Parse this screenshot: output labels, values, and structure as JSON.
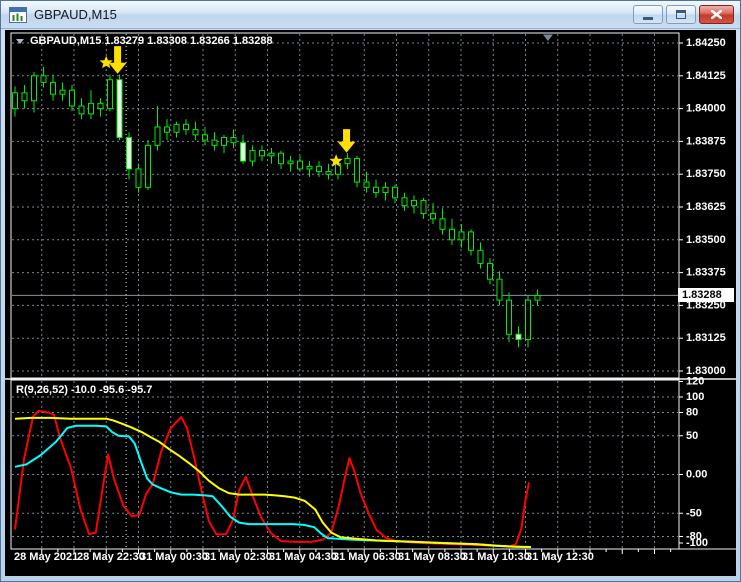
{
  "window": {
    "title": "GBPAUD,M15",
    "controls": {
      "minimize": "minimize",
      "restore": "restore",
      "close": "close"
    }
  },
  "chart": {
    "info_line": "GBPAUD,M15 1.83279 1.83308 1.83266 1.83288",
    "open": "1.83279",
    "high": "1.83308",
    "low": "1.83266",
    "close": "1.83288",
    "current_price": "1.83288"
  },
  "indicator": {
    "label": "R(9,26,52) -10.0 -95.6 -95.7"
  },
  "colors": {
    "background": "#000000",
    "grid": "#778899",
    "separator": "#e6ecf2",
    "panel_border": "#f2f2f2",
    "bar": "#00ee00",
    "solid_body_fill": "#eeffee",
    "hollow_body_fill": "#000000",
    "marker": "#ffdf00",
    "price_line": "#8d959d",
    "shift_marker": "#778899",
    "axis_text": "#ffffff",
    "tag_bg": "#ffffff",
    "tag_text": "#000000",
    "r9": "#ff0000",
    "r26": "#00ffff",
    "r52": "#ffff00"
  },
  "time_axis": {
    "labels": [
      "28 May 2021",
      "28 May 22:30",
      "31 May 00:30",
      "31 May 02:30",
      "31 May 04:30",
      "31 May 06:30",
      "31 May 08:30",
      "31 May 10:30",
      "31 May 12:30"
    ]
  },
  "chart_data": {
    "type": "candlestick",
    "symbol": "GBPAUD",
    "timeframe": "M15",
    "price_axis_labels": [
      "1.84250",
      "1.84125",
      "1.84000",
      "1.83875",
      "1.83750",
      "1.83625",
      "1.83500",
      "1.83375",
      "1.83250",
      "1.83125",
      "1.83000"
    ],
    "current_price": 1.83288,
    "day_separator_candle": 11.7,
    "shift_marker_candle": 56.1,
    "candles": [
      [
        1.84,
        1.84085,
        1.8397,
        1.8406
      ],
      [
        1.8406,
        1.8409,
        1.84,
        1.8403
      ],
      [
        1.8403,
        1.8414,
        1.83985,
        1.84125
      ],
      [
        1.84125,
        1.8416,
        1.8408,
        1.841
      ],
      [
        1.841,
        1.8413,
        1.8403,
        1.84055
      ],
      [
        1.84055,
        1.841,
        1.8403,
        1.8407
      ],
      [
        1.8407,
        1.8409,
        1.8399,
        1.8401
      ],
      [
        1.8401,
        1.8404,
        1.8396,
        1.8398
      ],
      [
        1.8398,
        1.8407,
        1.8396,
        1.8402
      ],
      [
        1.8402,
        1.8404,
        1.8397,
        1.84
      ],
      [
        1.84,
        1.8413,
        1.8399,
        1.8411
      ],
      [
        1.8411,
        1.8413,
        1.8388,
        1.8389,
        1
      ],
      [
        1.8389,
        1.8391,
        1.8373,
        1.8377,
        1
      ],
      [
        1.8377,
        1.8379,
        1.8368,
        1.837
      ],
      [
        1.837,
        1.8388,
        1.8369,
        1.8386
      ],
      [
        1.8386,
        1.8401,
        1.8384,
        1.8393
      ],
      [
        1.8393,
        1.8396,
        1.8388,
        1.8391
      ],
      [
        1.8391,
        1.8395,
        1.8389,
        1.8394
      ],
      [
        1.8394,
        1.8396,
        1.839,
        1.8392
      ],
      [
        1.8392,
        1.8395,
        1.8388,
        1.839
      ],
      [
        1.839,
        1.8393,
        1.8386,
        1.8388
      ],
      [
        1.8388,
        1.8391,
        1.8384,
        1.8386
      ],
      [
        1.8386,
        1.839,
        1.8383,
        1.8389
      ],
      [
        1.8389,
        1.8392,
        1.8385,
        1.8387
      ],
      [
        1.8387,
        1.839,
        1.8379,
        1.838,
        1
      ],
      [
        1.838,
        1.8386,
        1.8378,
        1.8384
      ],
      [
        1.8384,
        1.8386,
        1.838,
        1.8382
      ],
      [
        1.8382,
        1.8385,
        1.8379,
        1.8383
      ],
      [
        1.8383,
        1.8384,
        1.8377,
        1.8379
      ],
      [
        1.8379,
        1.8382,
        1.8376,
        1.838
      ],
      [
        1.838,
        1.8382,
        1.8376,
        1.8377
      ],
      [
        1.8377,
        1.838,
        1.8374,
        1.8378
      ],
      [
        1.8378,
        1.838,
        1.8374,
        1.8376
      ],
      [
        1.8376,
        1.8379,
        1.8373,
        1.8375
      ],
      [
        1.8375,
        1.838,
        1.8373,
        1.8379
      ],
      [
        1.8379,
        1.8383,
        1.8377,
        1.8381
      ],
      [
        1.8381,
        1.8382,
        1.837,
        1.8372
      ],
      [
        1.8372,
        1.8376,
        1.8368,
        1.837
      ],
      [
        1.837,
        1.8373,
        1.8366,
        1.8368
      ],
      [
        1.8368,
        1.8372,
        1.8365,
        1.837
      ],
      [
        1.837,
        1.8371,
        1.8364,
        1.8366
      ],
      [
        1.8366,
        1.8368,
        1.8361,
        1.8363
      ],
      [
        1.8363,
        1.8367,
        1.836,
        1.8365
      ],
      [
        1.8365,
        1.8366,
        1.8358,
        1.836
      ],
      [
        1.836,
        1.8364,
        1.8356,
        1.8358
      ],
      [
        1.8358,
        1.8362,
        1.8352,
        1.8354
      ],
      [
        1.8354,
        1.8358,
        1.8348,
        1.835
      ],
      [
        1.835,
        1.8356,
        1.8347,
        1.8353
      ],
      [
        1.8353,
        1.8354,
        1.8344,
        1.8346
      ],
      [
        1.8346,
        1.8349,
        1.8339,
        1.8341
      ],
      [
        1.8341,
        1.8343,
        1.8333,
        1.8335
      ],
      [
        1.8335,
        1.8338,
        1.8325,
        1.8327
      ],
      [
        1.8327,
        1.833,
        1.8311,
        1.8314
      ],
      [
        1.8314,
        1.8317,
        1.8309,
        1.8312,
        1
      ],
      [
        1.8312,
        1.8329,
        1.8309,
        1.8327
      ],
      [
        1.8327,
        1.8331,
        1.8325,
        1.83288
      ]
    ],
    "markers": [
      {
        "shape": "star",
        "candle": 9.6,
        "price": 1.84175
      },
      {
        "shape": "arrow-down",
        "candle": 10.8,
        "price_tail": 1.84238,
        "price_tip": 1.84133
      },
      {
        "shape": "star",
        "candle": 33.8,
        "price": 1.838
      },
      {
        "shape": "arrow-down",
        "candle": 34.9,
        "price_tail": 1.83922,
        "price_tip": 1.83832
      }
    ],
    "oscillator": {
      "name": "R",
      "params": [
        9,
        26,
        52
      ],
      "current_values": [
        -10.0,
        -95.6,
        -95.7
      ],
      "axis_labels": [
        "120",
        "100",
        "80",
        "50",
        "0.00",
        "-50",
        "-80",
        "-100"
      ],
      "range_hint": [
        120,
        -100
      ],
      "series": [
        {
          "name": "R9",
          "color_key": "r9",
          "points": [
            [
              0,
              -71
            ],
            [
              0.95,
              20
            ],
            [
              1.9,
              75
            ],
            [
              2.5,
              82
            ],
            [
              3.5,
              80
            ],
            [
              4.1,
              77
            ],
            [
              4.8,
              45
            ],
            [
              5.9,
              8
            ],
            [
              6.9,
              -45
            ],
            [
              7.8,
              -77
            ],
            [
              8.5,
              -75
            ],
            [
              9.2,
              -20
            ],
            [
              9.8,
              26
            ],
            [
              10.4,
              -5
            ],
            [
              11.4,
              -40
            ],
            [
              12.3,
              -54
            ],
            [
              13.1,
              -52
            ],
            [
              13.8,
              -25
            ],
            [
              14.5,
              -12
            ],
            [
              15.4,
              30
            ],
            [
              16.4,
              60
            ],
            [
              17.5,
              74
            ],
            [
              18.1,
              60
            ],
            [
              18.9,
              20
            ],
            [
              19.8,
              -30
            ],
            [
              20.4,
              -60
            ],
            [
              21.2,
              -77
            ],
            [
              22.2,
              -77
            ],
            [
              22.9,
              -60
            ],
            [
              23.6,
              -20
            ],
            [
              24.3,
              -3
            ],
            [
              25.1,
              -30
            ],
            [
              25.9,
              -55
            ],
            [
              26.9,
              -75
            ],
            [
              28,
              -86
            ],
            [
              29.6,
              -87
            ],
            [
              31.2,
              -87
            ],
            [
              32.4,
              -84
            ],
            [
              33.3,
              -75
            ],
            [
              34.1,
              -40
            ],
            [
              34.7,
              -5
            ],
            [
              35.2,
              21
            ],
            [
              35.7,
              5
            ],
            [
              36.4,
              -25
            ],
            [
              37.3,
              -52
            ],
            [
              38.1,
              -72
            ],
            [
              39.1,
              -82
            ],
            [
              40.1,
              -86
            ],
            [
              42.2,
              -88
            ],
            [
              44.3,
              -89
            ],
            [
              46.4,
              -90
            ],
            [
              48.5,
              -91
            ],
            [
              50.6,
              -92
            ],
            [
              52,
              -93
            ],
            [
              52.7,
              -90
            ],
            [
              53.3,
              -70
            ],
            [
              53.7,
              -35
            ],
            [
              54.1,
              -10
            ]
          ]
        },
        {
          "name": "R26",
          "color_key": "r26",
          "points": [
            [
              0,
              10
            ],
            [
              1.2,
              13
            ],
            [
              2.7,
              25
            ],
            [
              4.3,
              42
            ],
            [
              5.5,
              60
            ],
            [
              6.4,
              63
            ],
            [
              7.5,
              63
            ],
            [
              8.5,
              63
            ],
            [
              9.6,
              62
            ],
            [
              10.2,
              55
            ],
            [
              10.9,
              50
            ],
            [
              12,
              49
            ],
            [
              12.6,
              40
            ],
            [
              13.3,
              15
            ],
            [
              13.9,
              -5
            ],
            [
              14.5,
              -13
            ],
            [
              15.4,
              -18
            ],
            [
              16.4,
              -23
            ],
            [
              17.5,
              -26
            ],
            [
              18.7,
              -26
            ],
            [
              20,
              -27
            ],
            [
              20.8,
              -28
            ],
            [
              21.7,
              -40
            ],
            [
              22.7,
              -55
            ],
            [
              23.6,
              -62
            ],
            [
              24.6,
              -64
            ],
            [
              26.1,
              -64
            ],
            [
              27.8,
              -64
            ],
            [
              29.3,
              -64
            ],
            [
              30.4,
              -65
            ],
            [
              31.5,
              -68
            ],
            [
              32.2,
              -76
            ],
            [
              32.9,
              -82
            ],
            [
              34,
              -83
            ],
            [
              35.4,
              -84
            ],
            [
              37.3,
              -85
            ],
            [
              39.6,
              -86
            ],
            [
              41.9,
              -87
            ],
            [
              44.2,
              -88
            ],
            [
              46.5,
              -89
            ],
            [
              48.8,
              -90
            ],
            [
              50.9,
              -92
            ],
            [
              52.4,
              -93
            ],
            [
              53.5,
              -94
            ],
            [
              54.3,
              -95.6
            ]
          ]
        },
        {
          "name": "R52",
          "color_key": "r52",
          "points": [
            [
              0,
              72
            ],
            [
              1.7,
              73
            ],
            [
              3.8,
              73
            ],
            [
              5.9,
              72
            ],
            [
              8,
              72
            ],
            [
              9.6,
              72
            ],
            [
              10.3,
              70
            ],
            [
              11.2,
              66
            ],
            [
              12.2,
              61
            ],
            [
              13.3,
              55
            ],
            [
              14.3,
              48
            ],
            [
              15.2,
              42
            ],
            [
              16.2,
              33
            ],
            [
              17.3,
              24
            ],
            [
              18.3,
              15
            ],
            [
              19.4,
              4
            ],
            [
              20.4,
              -8
            ],
            [
              21.5,
              -18
            ],
            [
              22.5,
              -24
            ],
            [
              23.6,
              -26
            ],
            [
              25.1,
              -26
            ],
            [
              26.3,
              -26
            ],
            [
              27.4,
              -27
            ],
            [
              28.4,
              -28
            ],
            [
              29.5,
              -30
            ],
            [
              30.5,
              -34
            ],
            [
              31.6,
              -45
            ],
            [
              32.4,
              -62
            ],
            [
              33.3,
              -75
            ],
            [
              34.3,
              -81
            ],
            [
              35.9,
              -83
            ],
            [
              38,
              -85
            ],
            [
              40.1,
              -86
            ],
            [
              42.2,
              -87
            ],
            [
              44.3,
              -88
            ],
            [
              46.4,
              -89
            ],
            [
              48.5,
              -90
            ],
            [
              50.6,
              -92
            ],
            [
              52.4,
              -93
            ],
            [
              54.3,
              -95.7
            ]
          ]
        }
      ]
    }
  }
}
